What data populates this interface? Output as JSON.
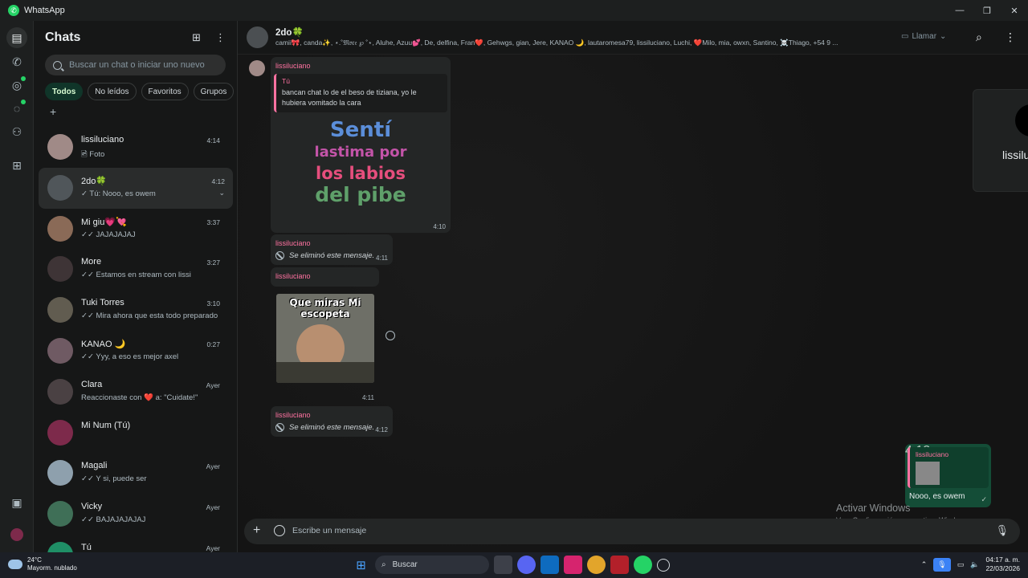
{
  "window": {
    "title": "WhatsApp",
    "controls": [
      "—",
      "❐",
      "✕"
    ]
  },
  "sidebar": {
    "title": "Chats",
    "search_placeholder": "Buscar un chat o iniciar uno nuevo",
    "filters": [
      "Todos",
      "No leídos",
      "Favoritos",
      "Grupos"
    ],
    "chats": [
      {
        "name": "lissiluciano",
        "preview": "🖻 Foto",
        "time": "4:14"
      },
      {
        "name": "2do🍀",
        "preview": "✓ Tú: Nooo, es owem",
        "time": "4:12"
      },
      {
        "name": "Mi giu💗💘",
        "preview": "✓✓ JAJAJAJAJ",
        "time": "3:37"
      },
      {
        "name": "More",
        "preview": "✓✓ Estamos en stream con lissi",
        "time": "3:27"
      },
      {
        "name": "Tuki Torres",
        "preview": "✓✓ Mira ahora que esta todo preparado",
        "time": "3:10"
      },
      {
        "name": "KANAO 🌙",
        "preview": "✓✓ Yyy, a eso es mejor axel",
        "time": "0:27"
      },
      {
        "name": "Clara",
        "preview": "Reaccionaste con ❤️ a: \"Cuidate!\"",
        "time": "Ayer"
      },
      {
        "name": "Mi Num (Tú)",
        "preview": "",
        "time": ""
      },
      {
        "name": "Magali",
        "preview": "✓✓ Y si, puede ser",
        "time": "Ayer"
      },
      {
        "name": "Vicky",
        "preview": "✓✓ BAJAJAJAJAJ",
        "time": "Ayer"
      },
      {
        "name": "Tú",
        "preview": "",
        "time": "Ayer"
      }
    ]
  },
  "conversation": {
    "name": "2do🍀",
    "members": "camii🎀, canda✨, ⋆.˚𝔐𝔬𝔯𝔢 ℘ ˚⋆, Aluhe, Azuu💕, De, delfina, Fran❤️, Gehwgs, gian, Jere, KANAO 🌙, lautaromesa79, lissiluciano, Luchi, ❤️Milo, mia, owxn, Santino, ☠️Thiago, +54 9 ...",
    "call_label": "Llamar",
    "messages": {
      "m1_sender": "lissiluciano",
      "m1_quote_author": "Tú",
      "m1_quote_text": "bancan chat lo de el beso de tiziana, yo le hubiera vomitado la cara",
      "m1_sticker": [
        "Sentí",
        "lastima por",
        "los labios",
        "del pibe"
      ],
      "m1_time": "4:10",
      "m2_sender": "lissiluciano",
      "m2_text": "Se eliminó este mensaje.",
      "m2_time": "4:11",
      "m3_sender": "lissiluciano",
      "m3_meme": "Que miras Mi escopeta",
      "m3_time": "4:11",
      "m4_sender": "lissiluciano",
      "m4_text": "Se eliminó este mensaje.",
      "m4_time": "4:12",
      "out_quote_author": "lissiluciano",
      "out_text": "Nooo, es owem",
      "out_time": "4:12"
    },
    "side_card_text": "lissilu",
    "composer_placeholder": "Escribe un mensaje"
  },
  "watermark": {
    "line1": "Activar Windows",
    "line2": "Ve a Configuración para activar Windows."
  },
  "taskbar": {
    "temp": "24°C",
    "weather": "Mayorm. nublado",
    "search": "Buscar",
    "time": "04:17 a. m.",
    "date": "22/03/2026"
  },
  "colors": {
    "accent": "#25d366",
    "sender": "#ff72a1",
    "outgoing": "#144d37"
  }
}
